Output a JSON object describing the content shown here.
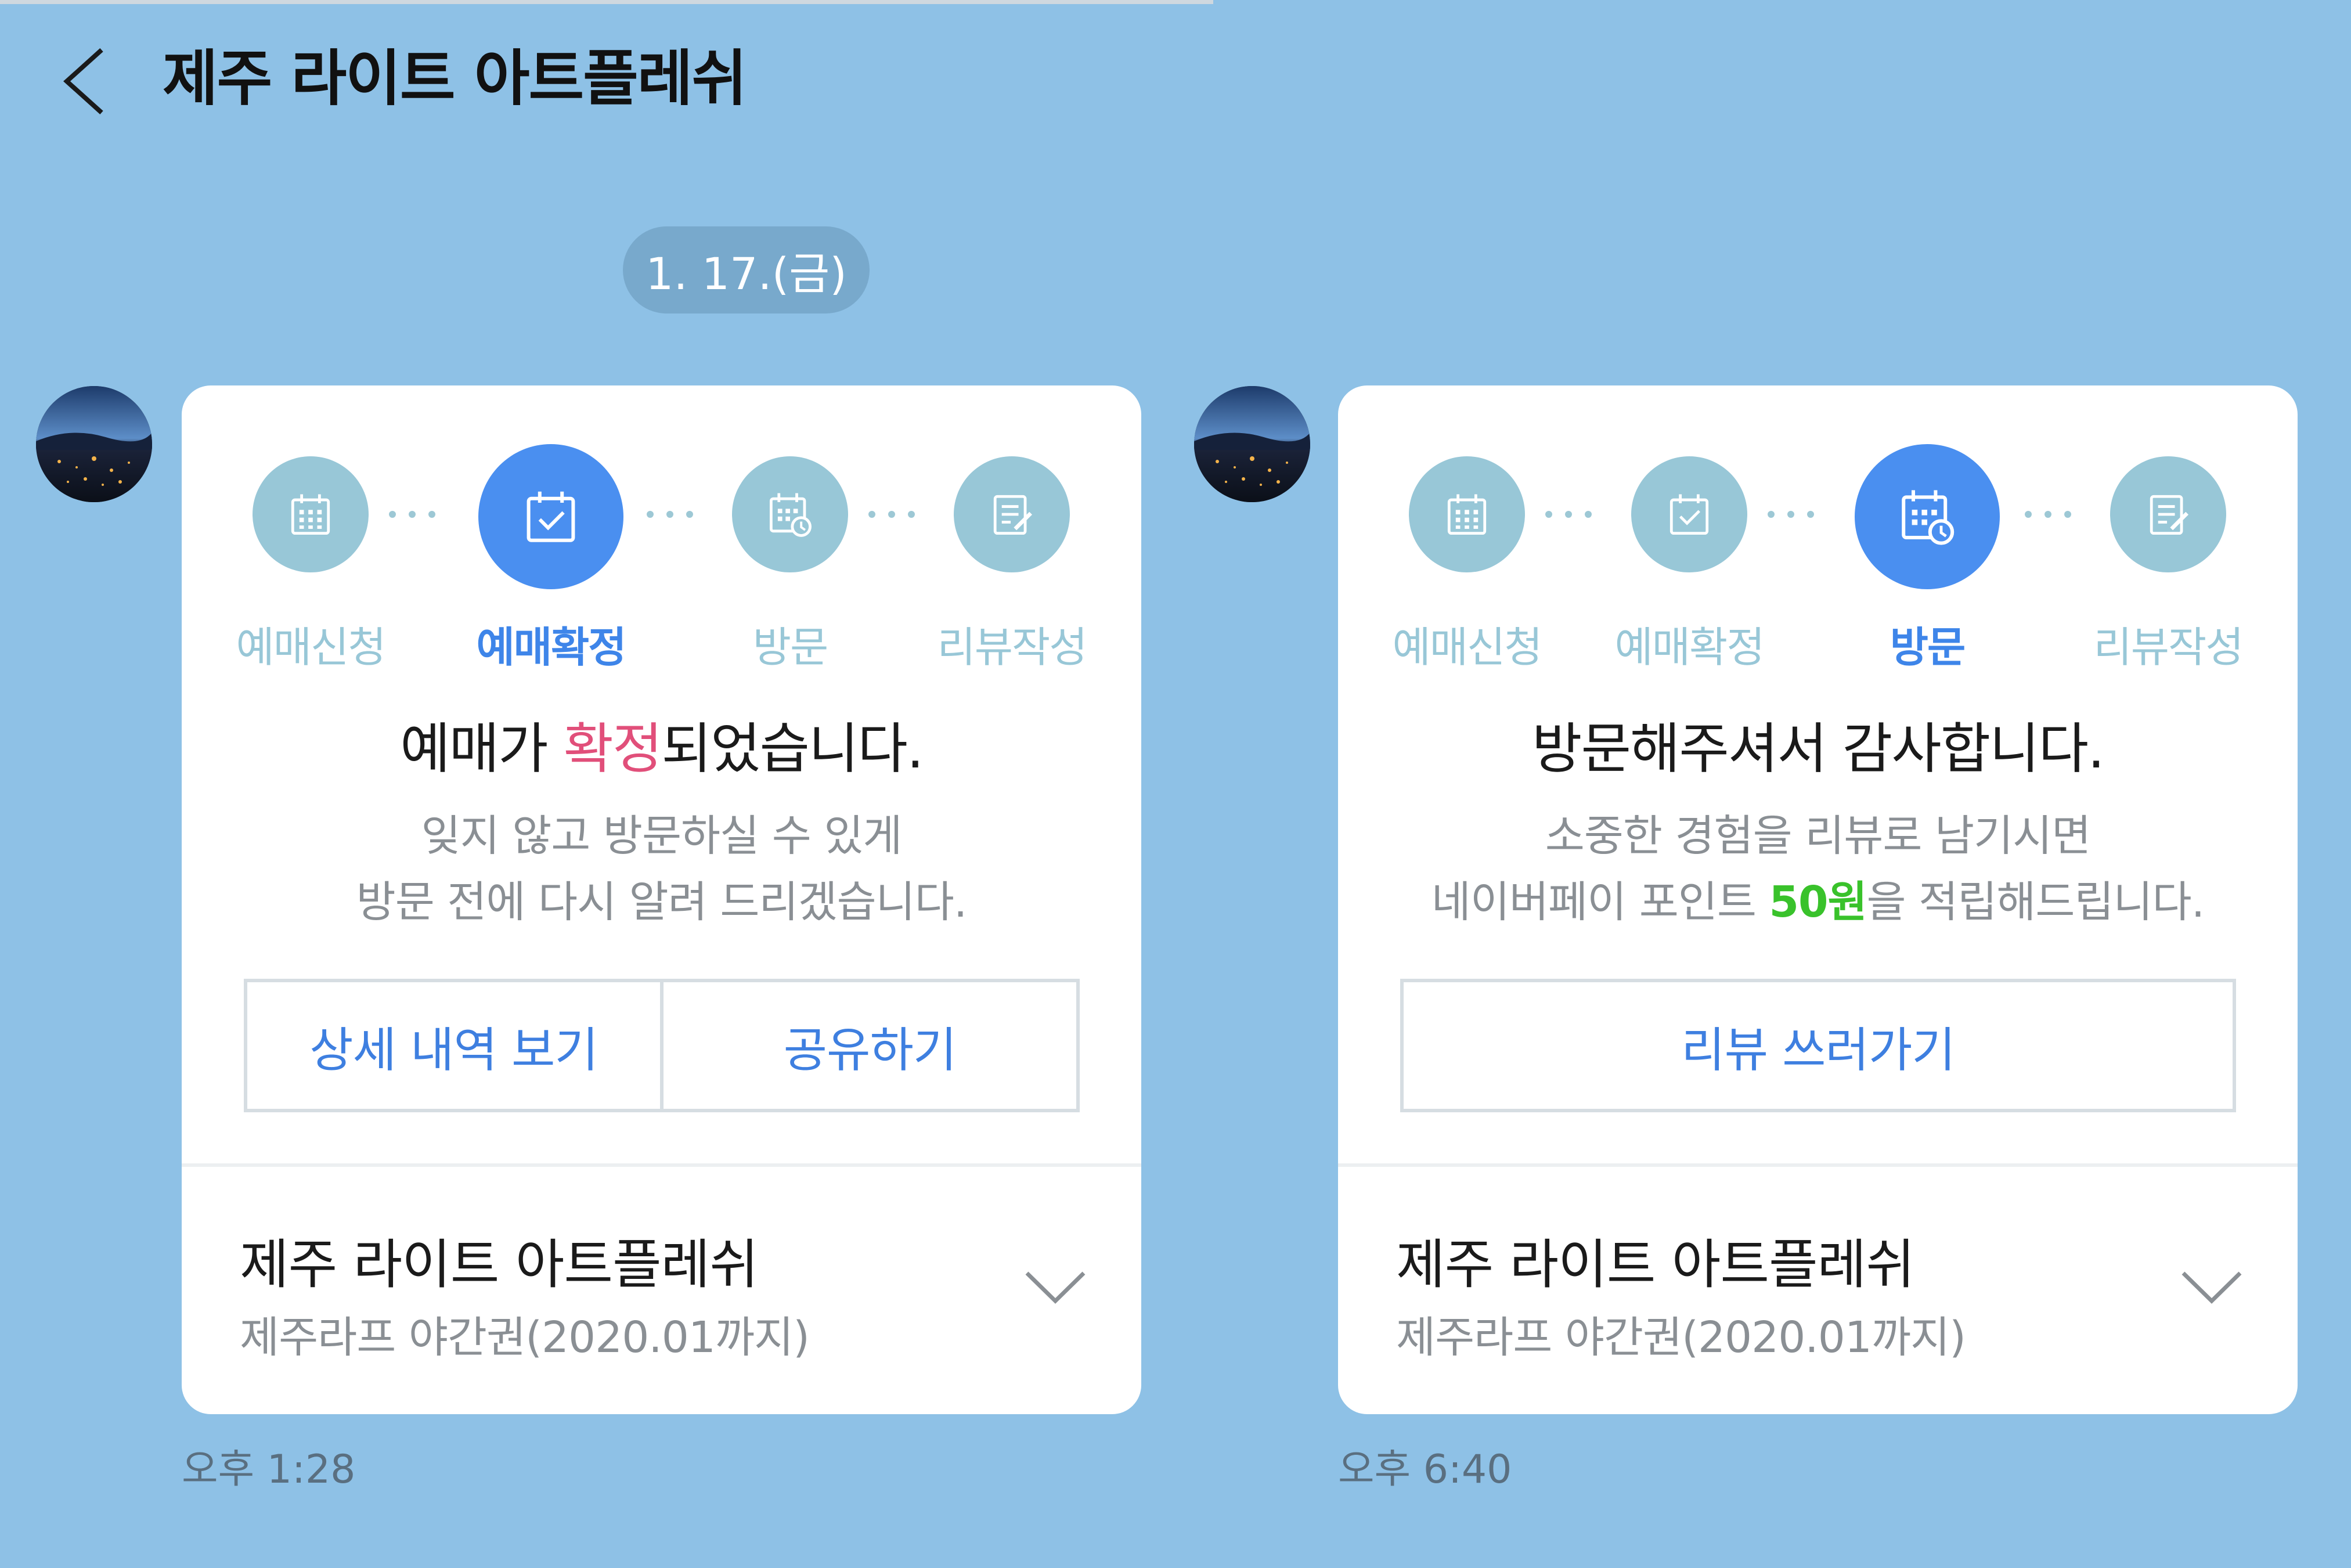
{
  "header": {
    "title": "제주 라이트 아트플레쉬"
  },
  "date_separator": "1. 17.(금)",
  "steps": [
    "예매신청",
    "예매확정",
    "방문",
    "리뷰작성"
  ],
  "messages": [
    {
      "active_step": "예매확정",
      "headline_pre": "예매가 ",
      "headline_hl": "확정",
      "headline_post": "되었습니다.",
      "sub_line1": "잊지 않고 방문하실 수 있게",
      "sub_line2": "방문 전에 다시 알려 드리겠습니다.",
      "buttons": [
        "상세 내역 보기",
        "공유하기"
      ],
      "place_name": "제주 라이트 아트플레쉬",
      "ticket_name": "제주라프 야간권(2020.01까지)",
      "time": "오후 1:28"
    },
    {
      "active_step": "방문",
      "headline": "방문해주셔서 감사합니다.",
      "sub_line1": "소중한 경험을 리뷰로 남기시면",
      "sub_line2_pre": "네이버페이 포인트 ",
      "sub_line2_hl": "50원",
      "sub_line2_post": "을 적립해드립니다.",
      "buttons": [
        "리뷰 쓰러가기"
      ],
      "place_name": "제주 라이트 아트플레쉬",
      "ticket_name": "제주라프 야간권(2020.01까지)",
      "time": "오후 6:40"
    }
  ],
  "colors": {
    "background": "#8ec1e6",
    "active_step": "#4a8ff0",
    "inactive_step": "#98c7d7",
    "highlight_red": "#e14f7a",
    "highlight_green": "#39c22b",
    "button_text": "#3e7fe0"
  },
  "icons": [
    "back-arrow-icon",
    "calendar-grid-icon",
    "calendar-check-icon",
    "calendar-clock-icon",
    "document-pen-icon",
    "chevron-down-icon"
  ]
}
